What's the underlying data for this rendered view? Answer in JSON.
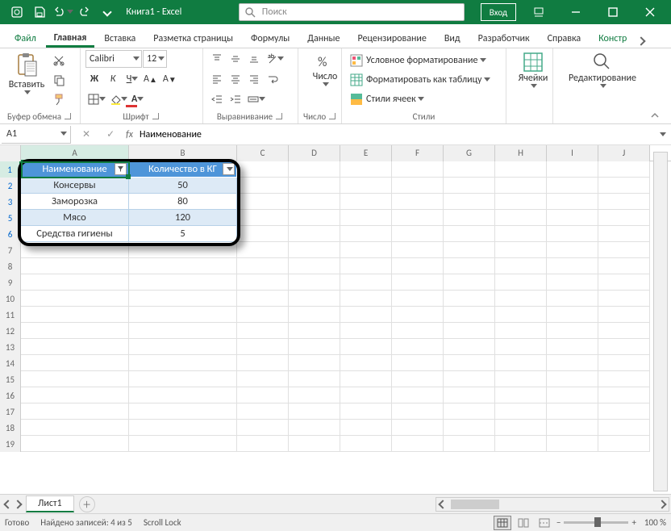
{
  "title": "Книга1 - Excel",
  "search_placeholder": "Поиск",
  "signin": "Вход",
  "tabs": {
    "file": "Файл",
    "home": "Главная",
    "insert": "Вставка",
    "layout": "Разметка страницы",
    "formulas": "Формулы",
    "data": "Данные",
    "review": "Рецензирование",
    "view": "Вид",
    "developer": "Разработчик",
    "help": "Справка",
    "design": "Констр"
  },
  "ribbon": {
    "paste": "Вставить",
    "clipboard": "Буфер обмена",
    "font": "Шрифт",
    "fontname": "Calibri",
    "fontsize": "12",
    "align": "Выравнивание",
    "number": "Число",
    "numberlbl": "Число",
    "styles": "Стили",
    "cells": "Ячейки",
    "editing": "Редактирование",
    "cond": "Условное форматирование",
    "astable": "Форматировать как таблицу",
    "cellstyles": "Стили ячеек",
    "bold": "Ж",
    "italic": "К",
    "underline": "Ч"
  },
  "namebox": "A1",
  "formula": "Наименование",
  "cols": [
    "A",
    "B",
    "C",
    "D",
    "E",
    "F",
    "G",
    "H",
    "I",
    "J"
  ],
  "rownums": [
    "1",
    "2",
    "3",
    "5",
    "6",
    "7",
    "8",
    "9",
    "10",
    "11",
    "12",
    "13",
    "14",
    "15",
    "16",
    "17",
    "18",
    "19"
  ],
  "tableRows": [
    [
      "Наименование",
      "Количество в КГ"
    ],
    [
      "Консервы",
      "50"
    ],
    [
      "Заморозка",
      "80"
    ],
    [
      "Мясо",
      "120"
    ],
    [
      "Средства гигиены",
      "5"
    ]
  ],
  "sheettab": "Лист1",
  "status": {
    "ready": "Готово",
    "found": "Найдено записей: 4 из 5",
    "scroll": "Scroll Lock",
    "zoom": "100 %"
  }
}
